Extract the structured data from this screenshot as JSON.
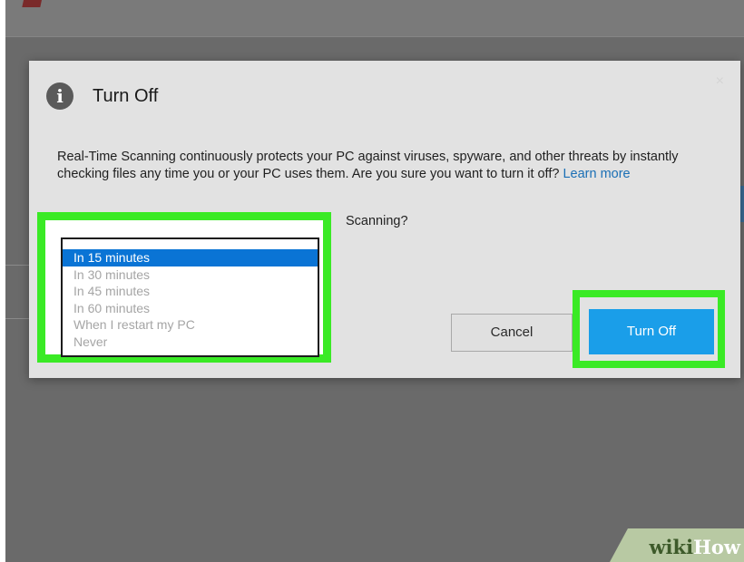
{
  "dialog": {
    "title": "Turn Off",
    "body": "Real-Time Scanning continuously protects your PC against viruses, spyware, and other threats by instantly checking files any time you or your PC uses them. Are you sure you want to turn it off?",
    "learn_more": "Learn more",
    "question_tail": "Scanning?",
    "icon": "info-icon",
    "close_glyph": "×"
  },
  "resume_options": [
    {
      "label": "In 15 minutes",
      "selected": true
    },
    {
      "label": "In 30 minutes",
      "selected": false
    },
    {
      "label": "In 45 minutes",
      "selected": false
    },
    {
      "label": "In 60 minutes",
      "selected": false
    },
    {
      "label": "When I restart my PC",
      "selected": false
    },
    {
      "label": "Never",
      "selected": false
    }
  ],
  "buttons": {
    "cancel": "Cancel",
    "turn_off": "Turn Off"
  },
  "watermark": {
    "wiki": "wiki",
    "how": "How"
  },
  "colors": {
    "highlight": "#3aea25",
    "accent": "#1a9ee9",
    "selection": "#0a74d5"
  }
}
